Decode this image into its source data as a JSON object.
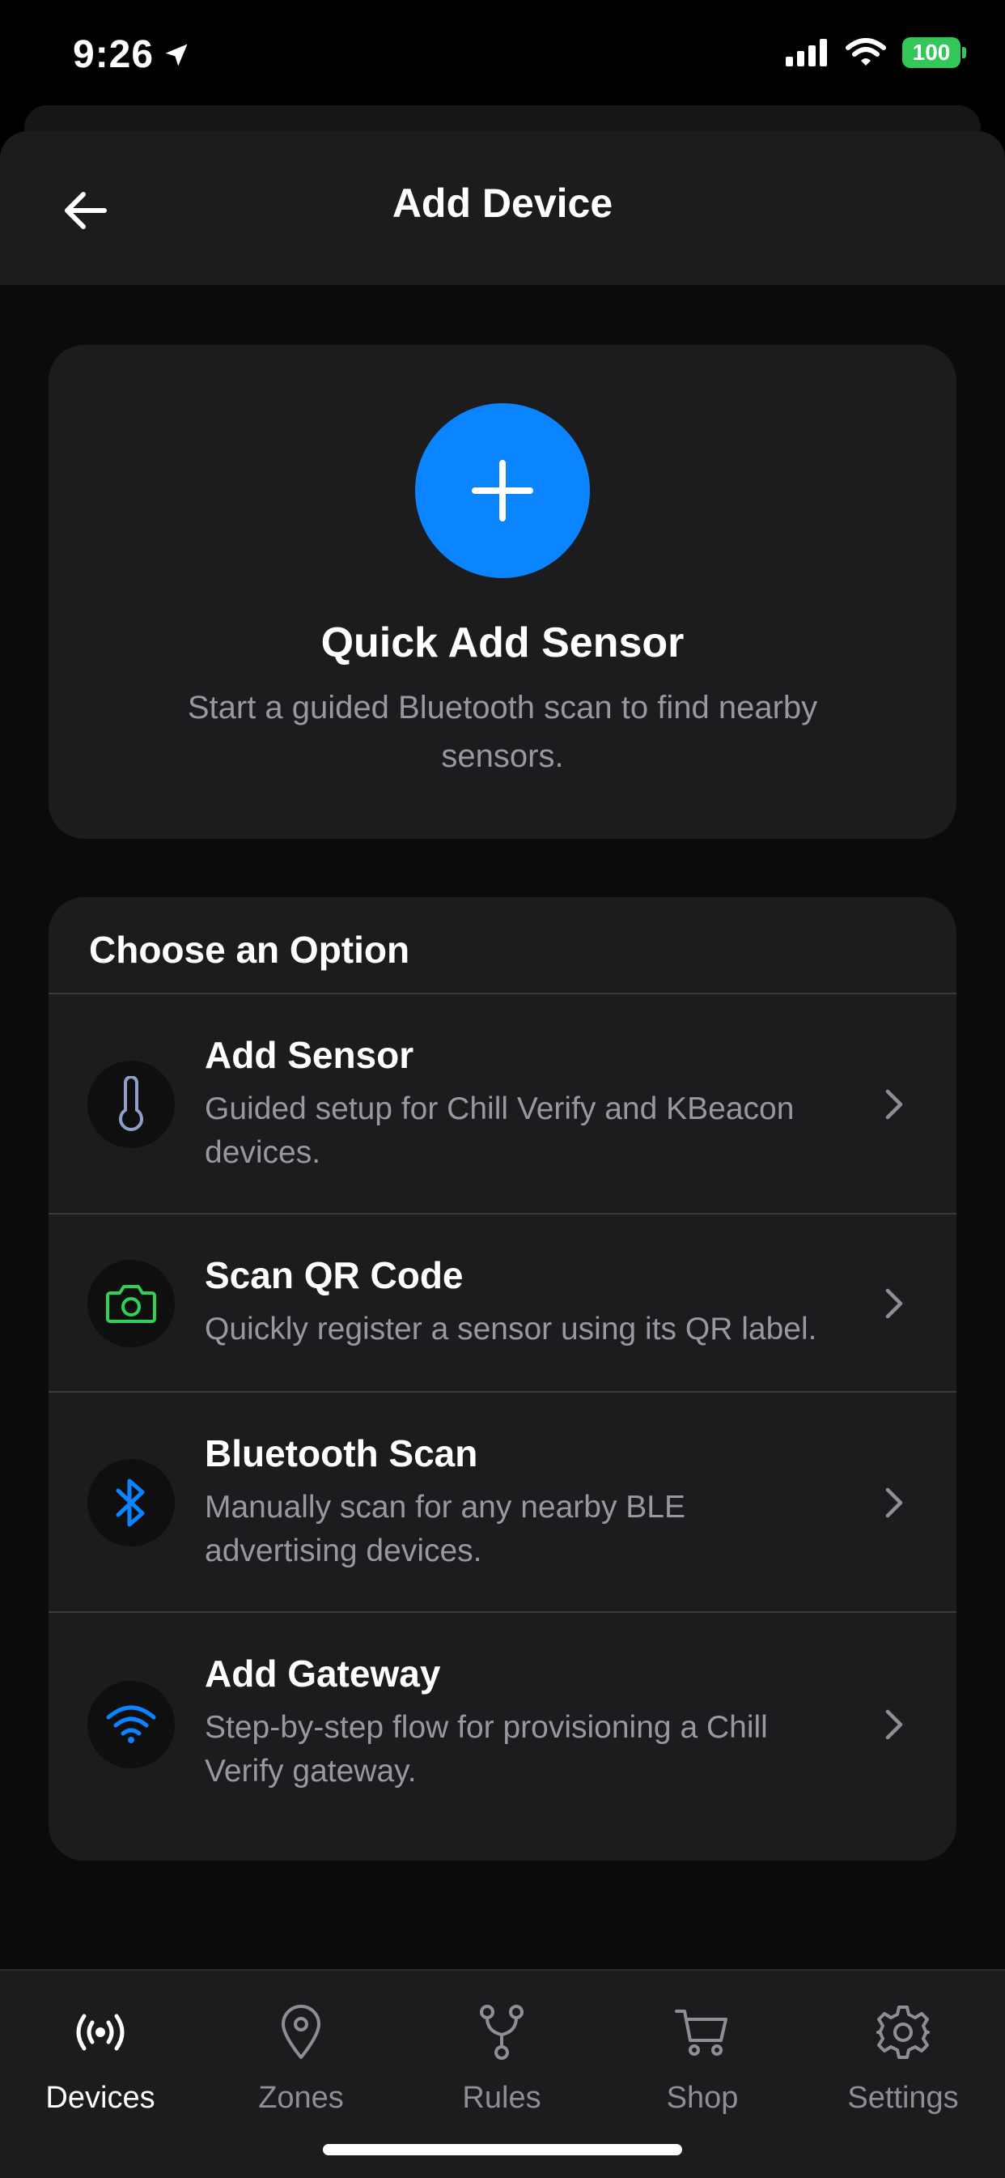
{
  "status_bar": {
    "time": "9:26",
    "battery": "100"
  },
  "header": {
    "title": "Add Device"
  },
  "quick_add": {
    "title": "Quick Add Sensor",
    "subtitle_line1": "Start a guided Bluetooth scan to find nearby",
    "subtitle_line2": "sensors."
  },
  "options": {
    "title": "Choose an Option",
    "items": [
      {
        "title": "Add Sensor",
        "desc_line1": "Guided setup for Chill Verify and KBeacon",
        "desc_line2": "devices.",
        "icon": "thermometer-icon",
        "icon_color": "#8ea0c8"
      },
      {
        "title": "Scan QR Code",
        "desc_line1": "Quickly register a sensor using its QR label.",
        "desc_line2": "",
        "icon": "camera-icon",
        "icon_color": "#30d158"
      },
      {
        "title": "Bluetooth Scan",
        "desc_line1": "Manually scan for any nearby BLE",
        "desc_line2": "advertising devices.",
        "icon": "bluetooth-icon",
        "icon_color": "#0a84ff"
      },
      {
        "title": "Add Gateway",
        "desc_line1": "Step-by-step flow for provisioning a Chill",
        "desc_line2": "Verify gateway.",
        "icon": "wifi-icon",
        "icon_color": "#0a84ff"
      }
    ]
  },
  "tabs": [
    {
      "label": "Devices",
      "icon": "broadcast-icon",
      "active": true
    },
    {
      "label": "Zones",
      "icon": "location-pin-icon",
      "active": false
    },
    {
      "label": "Rules",
      "icon": "branch-icon",
      "active": false
    },
    {
      "label": "Shop",
      "icon": "cart-icon",
      "active": false
    },
    {
      "label": "Settings",
      "icon": "gear-icon",
      "active": false
    }
  ],
  "colors": {
    "accent": "#0a84ff",
    "card": "#1c1c1e",
    "background": "#0b0b0c",
    "secondary_text": "#98989e",
    "battery": "#33c759"
  }
}
